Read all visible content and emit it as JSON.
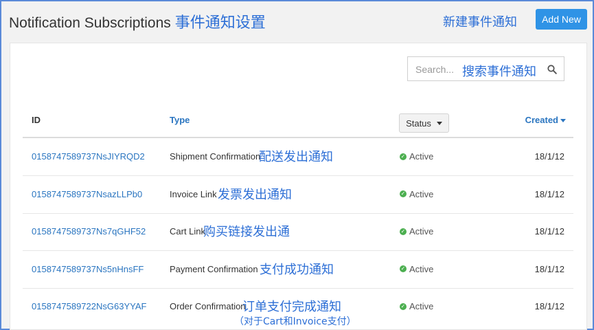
{
  "header": {
    "title": "Notification Subscriptions",
    "title_note": "事件通知设置",
    "add_note": "新建事件通知",
    "add_label": "Add New"
  },
  "search": {
    "placeholder": "Search...",
    "note": "搜索事件通知",
    "icon": "search-icon"
  },
  "table": {
    "columns": {
      "id": "ID",
      "type": "Type",
      "status": "Status",
      "created": "Created"
    },
    "rows": [
      {
        "id": "0158747589737NsJIYRQD2",
        "type": "Shipment Confirmation",
        "note": "配送发出通知",
        "note2": "",
        "status": "Active",
        "created": "18/1/12"
      },
      {
        "id": "0158747589737NsazLLPb0",
        "type": "Invoice Link",
        "note": "发票发出通知",
        "note2": "",
        "status": "Active",
        "created": "18/1/12"
      },
      {
        "id": "0158747589737Ns7qGHF52",
        "type": "Cart Link",
        "note": "购买链接发出通",
        "note2": "",
        "status": "Active",
        "created": "18/1/12"
      },
      {
        "id": "0158747589737Ns5nHnsFF",
        "type": "Payment Confirmation",
        "note": "支付成功通知",
        "note2": "",
        "status": "Active",
        "created": "18/1/12"
      },
      {
        "id": "0158747589722NsG63YYAF",
        "type": "Order Confirmation",
        "note": "订单支付完成通知",
        "note2": "（对于Cart和Invoice支付）",
        "status": "Active",
        "created": "18/1/12"
      }
    ]
  },
  "colors": {
    "accent": "#2f93e6",
    "link": "#2a75c0",
    "annotation": "#2d6fd6",
    "active": "#4caf50"
  }
}
